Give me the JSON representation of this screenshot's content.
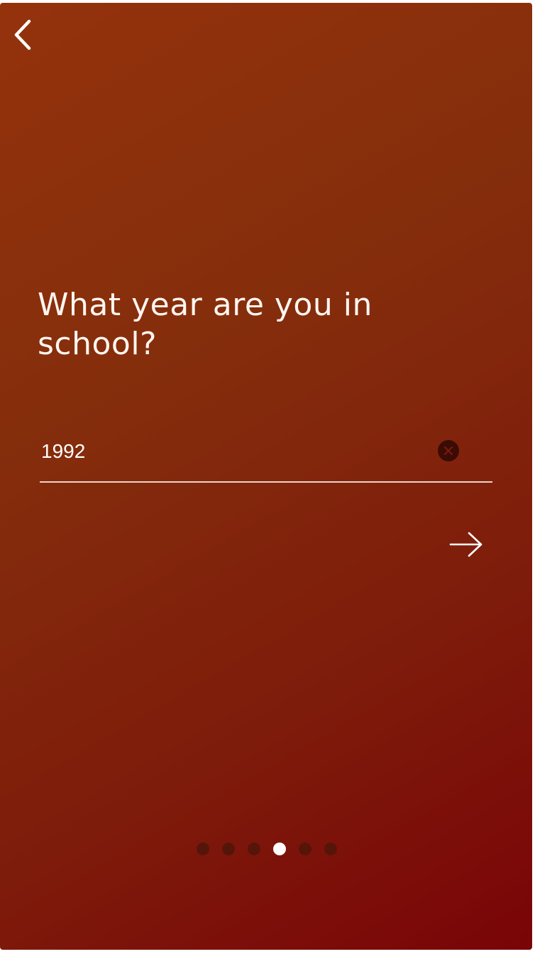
{
  "screen": {
    "question": "What year are you in school?",
    "colors": {
      "gradient_start": "#94320c",
      "gradient_end": "#7a0407",
      "text": "#fff6f0",
      "inactive_dot": "#561509",
      "active_dot": "#ffffff"
    }
  },
  "nav": {
    "back_icon": "chevron-left-icon"
  },
  "year_field": {
    "value": "1992",
    "clear_icon": "close-circle-icon"
  },
  "next": {
    "icon": "arrow-right-icon"
  },
  "pager": {
    "total": 6,
    "active_index": 3
  }
}
